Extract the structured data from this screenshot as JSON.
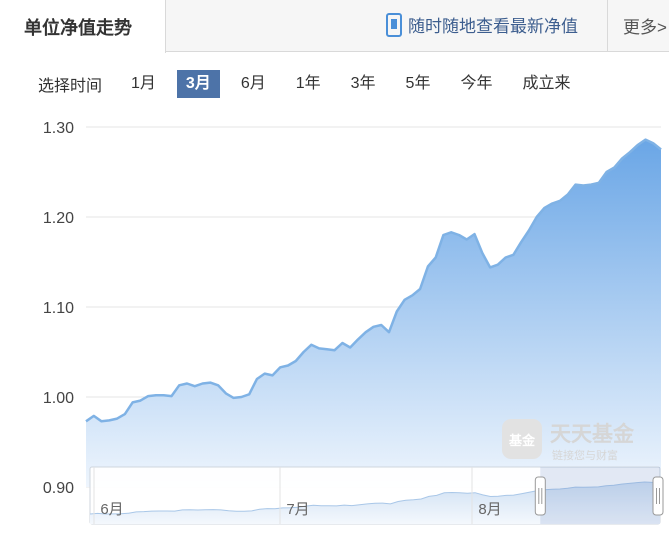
{
  "header": {
    "title": "单位净值走势",
    "promo_text": "随时随地查看最新净值",
    "more_label": "更多>"
  },
  "time_selector": {
    "label": "选择时间",
    "options": [
      "1月",
      "3月",
      "6月",
      "1年",
      "3年",
      "5年",
      "今年",
      "成立来"
    ],
    "selected": "3月"
  },
  "watermark": {
    "brand": "天天基金",
    "slogan": "链接您与财富",
    "badge": "基金"
  },
  "navigator": {
    "month_labels": [
      "6月",
      "7月",
      "8月"
    ],
    "selection_start": 0.79,
    "selection_end": 1.0
  },
  "colors": {
    "line": "#7fb2e5",
    "fill_top": "#6aa6e6",
    "fill_bottom": "#eef5fd",
    "grid": "#e6e6e6",
    "selected_button": "#4d73a8"
  },
  "chart_data": {
    "type": "area",
    "title": "",
    "xlabel": "",
    "ylabel": "",
    "ylim": [
      0.9,
      1.3
    ],
    "y_ticks": [
      "0.90",
      "1.00",
      "1.10",
      "1.20",
      "1.30"
    ],
    "series": [
      {
        "values": [
          0.973,
          0.979,
          0.973,
          0.974,
          0.976,
          0.981,
          0.994,
          0.996,
          1.001,
          1.002,
          1.002,
          1.001,
          1.013,
          1.015,
          1.012,
          1.015,
          1.016,
          1.013,
          1.004,
          0.999,
          1.0,
          1.003,
          1.02,
          1.026,
          1.024,
          1.033,
          1.035,
          1.04,
          1.05,
          1.058,
          1.054,
          1.053,
          1.052,
          1.06,
          1.055,
          1.064,
          1.072,
          1.078,
          1.08,
          1.072,
          1.095,
          1.108,
          1.113,
          1.12,
          1.145,
          1.155,
          1.18,
          1.183,
          1.18,
          1.175,
          1.181,
          1.16,
          1.144,
          1.147,
          1.155,
          1.158,
          1.172,
          1.185,
          1.2,
          1.21,
          1.215,
          1.218,
          1.225,
          1.236,
          1.235,
          1.236,
          1.238,
          1.25,
          1.255,
          1.265,
          1.272,
          1.28,
          1.286,
          1.282,
          1.275
        ]
      }
    ]
  }
}
